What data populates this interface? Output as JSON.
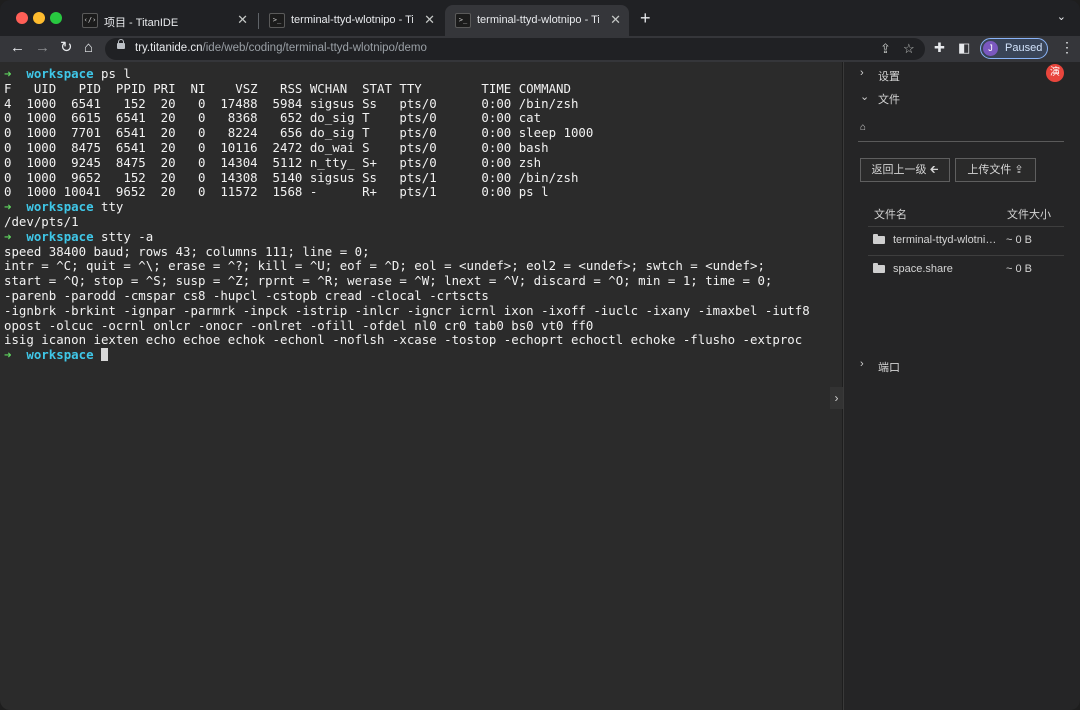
{
  "browser": {
    "tabs": [
      {
        "title": "项目 - TitanIDE",
        "icon": "code-brackets-icon",
        "icon_glyph": "‹/›"
      },
      {
        "title": "terminal-ttyd-wlotnipo - TitanIDE",
        "icon": "terminal-icon",
        "icon_glyph": ">_"
      },
      {
        "title": "terminal-ttyd-wlotnipo - TitanIDE",
        "icon": "terminal-icon",
        "icon_glyph": ">_"
      }
    ],
    "url_host": "try.titanide.cn",
    "url_path": "/ide/web/coding/terminal-ttyd-wlotnipo/demo",
    "profile_initial": "J",
    "profile_status": "Paused"
  },
  "colors": {
    "prompt_arrow": "#5fd35f",
    "prompt_cwd": "#3fc7e8",
    "terminal_bg": "#2b2b2b",
    "panel_bg": "#252526",
    "badge": "#e8453c"
  },
  "terminal": {
    "lines": [
      {
        "prompt": true,
        "arrow": "➜",
        "cwd": "workspace",
        "cmd": " ps l"
      },
      {
        "text": "F   UID   PID  PPID PRI  NI    VSZ   RSS WCHAN  STAT TTY        TIME COMMAND"
      },
      {
        "text": "4  1000  6541   152  20   0  17488  5984 sigsus Ss   pts/0      0:00 /bin/zsh"
      },
      {
        "text": "0  1000  6615  6541  20   0   8368   652 do_sig T    pts/0      0:00 cat"
      },
      {
        "text": "0  1000  7701  6541  20   0   8224   656 do_sig T    pts/0      0:00 sleep 1000"
      },
      {
        "text": "0  1000  8475  6541  20   0  10116  2472 do_wai S    pts/0      0:00 bash"
      },
      {
        "text": "0  1000  9245  8475  20   0  14304  5112 n_tty_ S+   pts/0      0:00 zsh"
      },
      {
        "text": "0  1000  9652   152  20   0  14308  5140 sigsus Ss   pts/1      0:00 /bin/zsh"
      },
      {
        "text": "0  1000 10041  9652  20   0  11572  1568 -      R+   pts/1      0:00 ps l"
      },
      {
        "prompt": true,
        "arrow": "➜",
        "cwd": "workspace",
        "cmd": " tty"
      },
      {
        "text": "/dev/pts/1"
      },
      {
        "prompt": true,
        "arrow": "➜",
        "cwd": "workspace",
        "cmd": " stty -a"
      },
      {
        "text": "speed 38400 baud; rows 43; columns 111; line = 0;"
      },
      {
        "text": "intr = ^C; quit = ^\\; erase = ^?; kill = ^U; eof = ^D; eol = <undef>; eol2 = <undef>; swtch = <undef>;"
      },
      {
        "text": "start = ^Q; stop = ^S; susp = ^Z; rprnt = ^R; werase = ^W; lnext = ^V; discard = ^O; min = 1; time = 0;"
      },
      {
        "text": "-parenb -parodd -cmspar cs8 -hupcl -cstopb cread -clocal -crtscts"
      },
      {
        "text": "-ignbrk -brkint -ignpar -parmrk -inpck -istrip -inlcr -igncr icrnl ixon -ixoff -iuclc -ixany -imaxbel -iutf8"
      },
      {
        "text": "opost -olcuc -ocrnl onlcr -onocr -onlret -ofill -ofdel nl0 cr0 tab0 bs0 vt0 ff0"
      },
      {
        "text": "isig icanon iexten echo echoe echok -echonl -noflsh -xcase -tostop -echoprt echoctl echoke -flusho -extproc"
      },
      {
        "prompt": true,
        "arrow": "➜",
        "cwd": "workspace",
        "cmd": " ",
        "cursor": true
      }
    ]
  },
  "panel": {
    "settings_label": "设置",
    "files_label": "文件",
    "ports_label": "端口",
    "badge_text": "演",
    "back_button": "返回上一级 🡰",
    "upload_button": "上传文件 ⇪",
    "col_name": "文件名",
    "col_size": "文件大小",
    "files": [
      {
        "name": "terminal-ttyd-wlotnipo",
        "size": "~ 0 B"
      },
      {
        "name": "space.share",
        "size": "~ 0 B"
      }
    ]
  }
}
